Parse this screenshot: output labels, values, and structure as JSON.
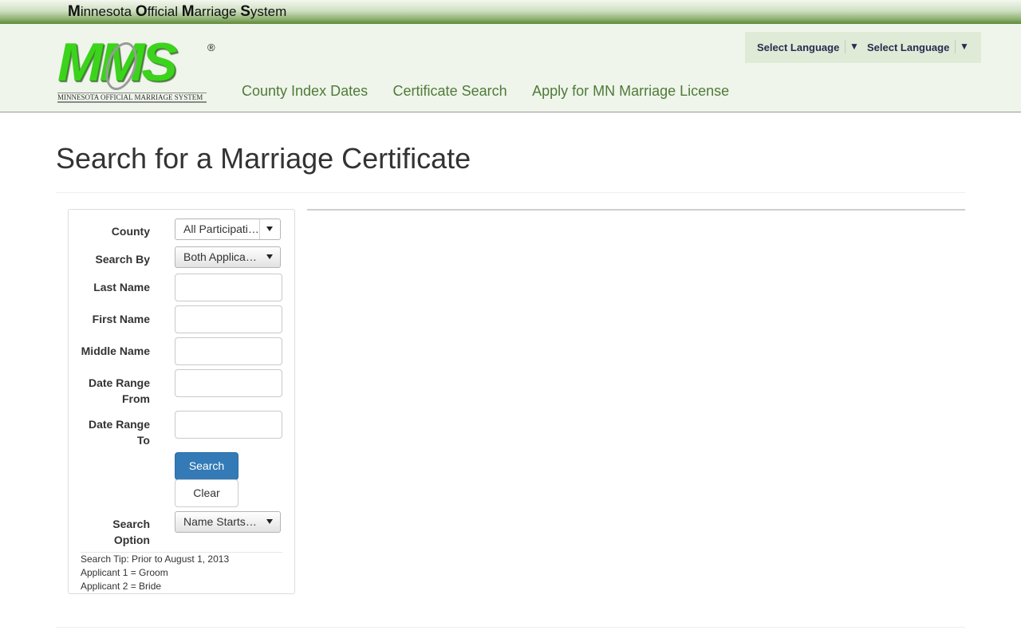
{
  "topbar": {
    "title_parts": [
      {
        "initial": "M",
        "rest": "innesota "
      },
      {
        "initial": "O",
        "rest": "fficial "
      },
      {
        "initial": "M",
        "rest": "arriage "
      },
      {
        "initial": "S",
        "rest": "ystem"
      }
    ]
  },
  "logo": {
    "wordmark": "MMS",
    "registered": "®",
    "subtitle": "MINNESOTA OFFICIAL MARRIAGE SYSTEM",
    "brand_color": "#3cd31c"
  },
  "nav": {
    "items": [
      {
        "label": "County Index Dates"
      },
      {
        "label": "Certificate Search"
      },
      {
        "label": "Apply for MN Marriage License"
      }
    ],
    "link_color": "#4f7a3a"
  },
  "language": {
    "selectors": [
      {
        "label": "Select Language",
        "caret": "▼"
      },
      {
        "label": "Select Language",
        "caret": "▼"
      }
    ]
  },
  "page": {
    "title": "Search for a Marriage Certificate"
  },
  "form": {
    "county": {
      "label": "County",
      "value": "All Participating Counties"
    },
    "search_by": {
      "label": "Search By",
      "value": "Both Applicants"
    },
    "last_name": {
      "label": "Last Name",
      "value": ""
    },
    "first_name": {
      "label": "First Name",
      "value": ""
    },
    "middle_name": {
      "label": "Middle Name",
      "value": ""
    },
    "date_from": {
      "label_line1": "Date Range",
      "label_line2": "From",
      "value": ""
    },
    "date_to": {
      "label_line1": "Date Range",
      "label_line2": "To",
      "value": ""
    },
    "search_button": "Search",
    "clear_button": "Clear",
    "search_option": {
      "label_line1": "Search",
      "label_line2": "Option",
      "value": "Name Starts With"
    },
    "tips": [
      "Search Tip: Prior to August 1, 2013",
      "Applicant 1 = Groom",
      "Applicant 2 = Bride"
    ],
    "primary_color": "#337ab7"
  }
}
